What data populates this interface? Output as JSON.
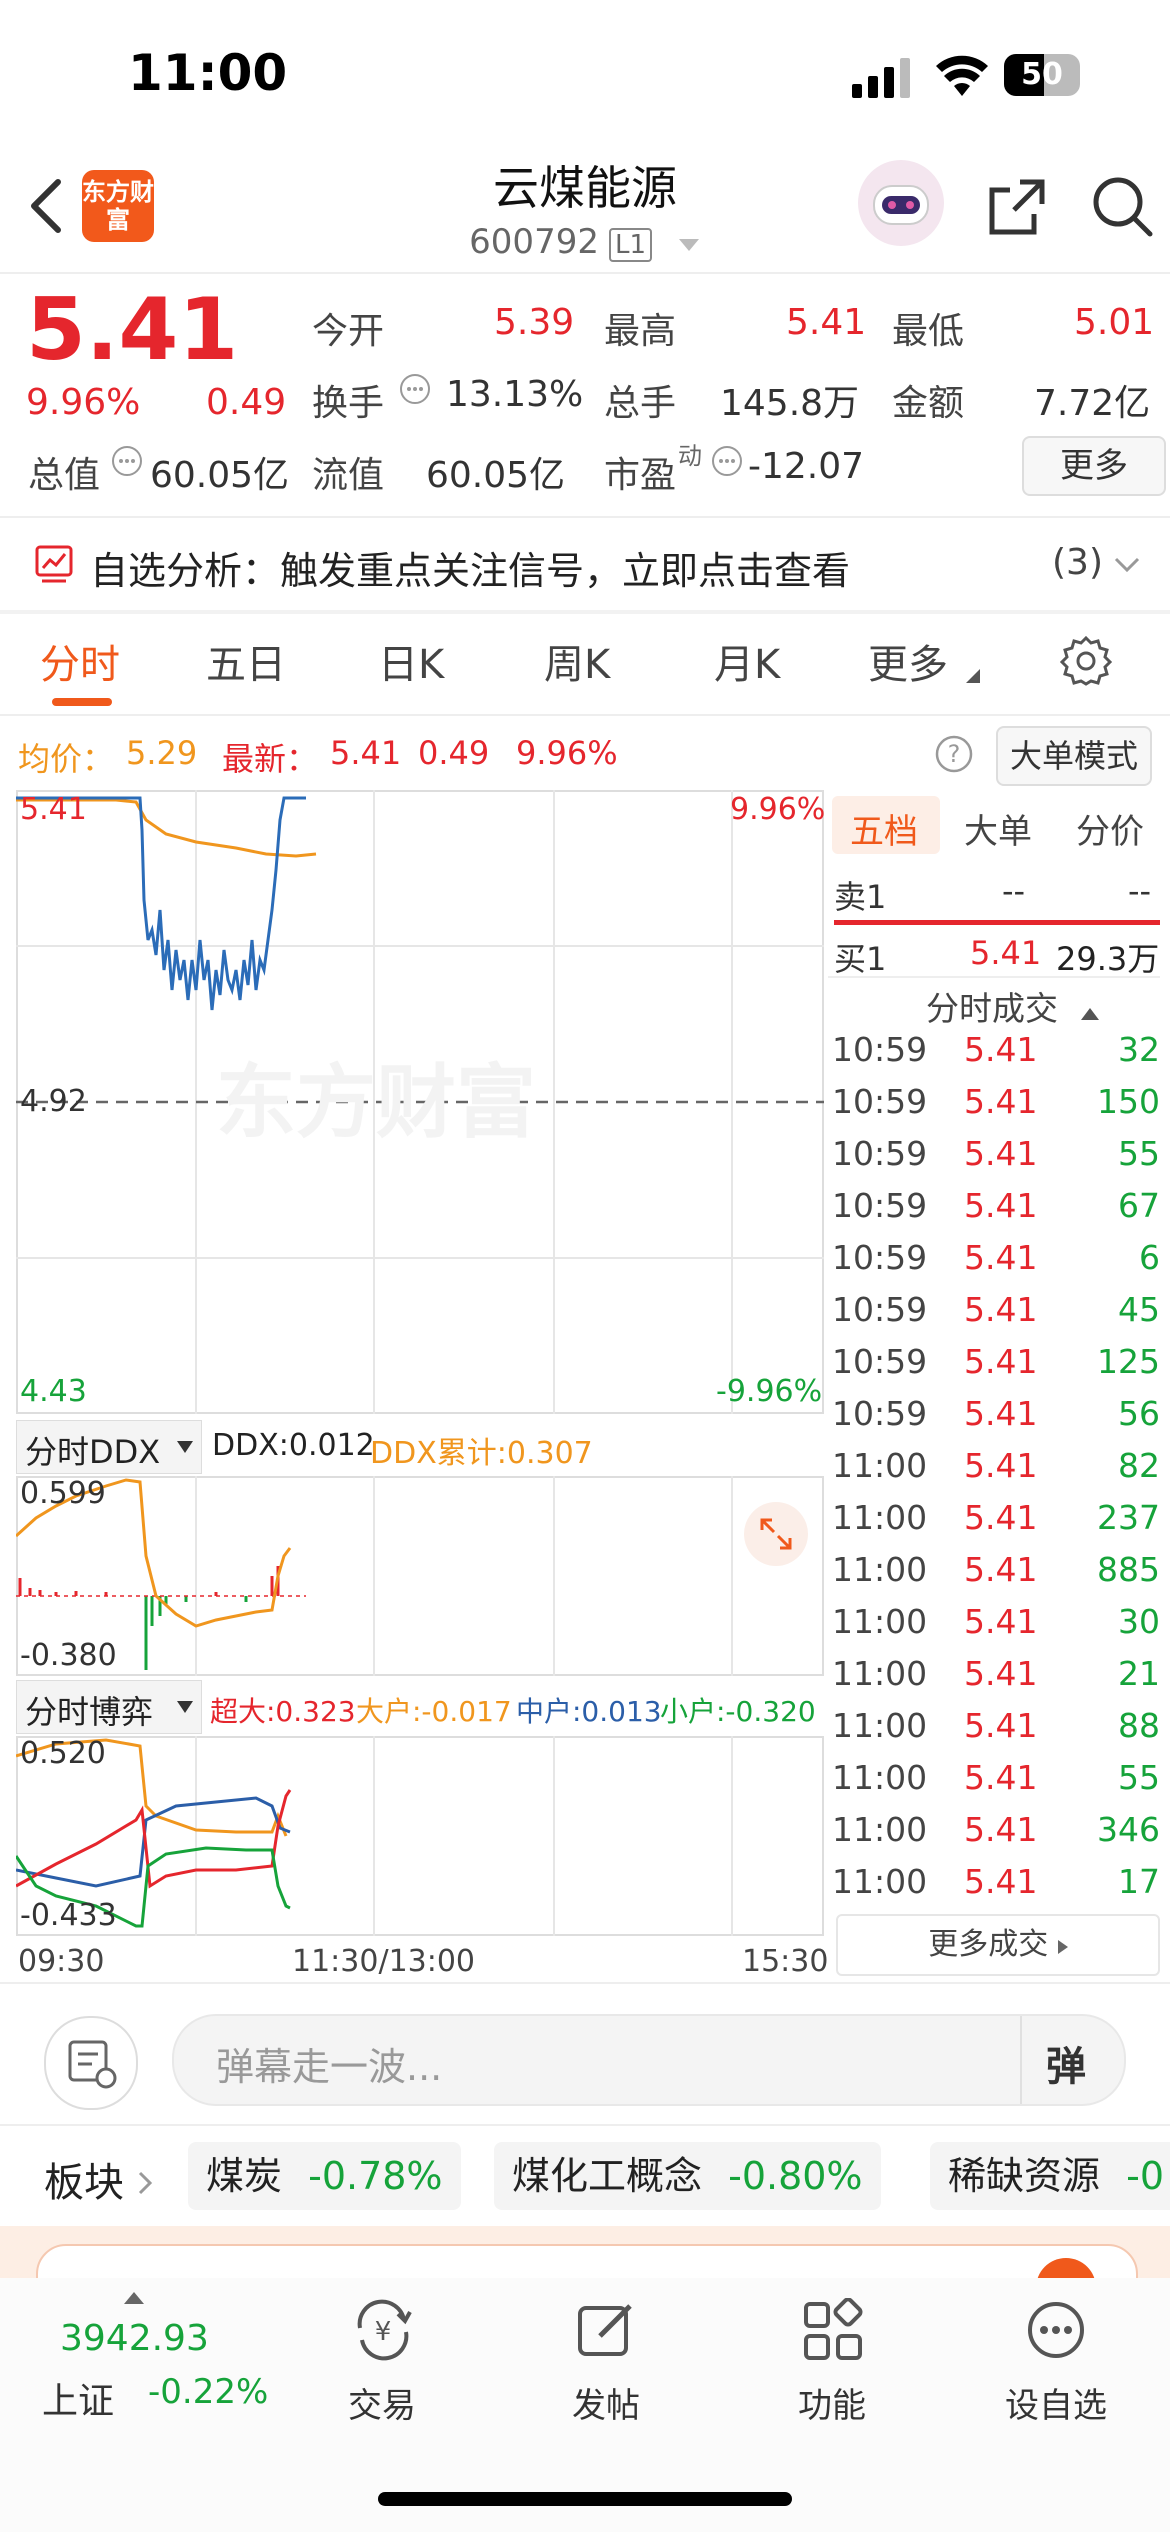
{
  "status_bar": {
    "time": "11:00",
    "battery": "50"
  },
  "header": {
    "logo_text": "东方财富",
    "title": "云煤能源",
    "code": "600792",
    "level": "L1"
  },
  "quote": {
    "price": "5.41",
    "change_pct": "9.96%",
    "change": "0.49",
    "open_label": "今开",
    "open": "5.39",
    "high_label": "最高",
    "high": "5.41",
    "low_label": "最低",
    "low": "5.01",
    "turnover_label": "换手",
    "turnover": "13.13%",
    "volume_label": "总手",
    "volume": "145.8万",
    "amount_label": "金额",
    "amount": "7.72亿",
    "mktcap_label": "总值",
    "mktcap": "60.05亿",
    "float_label": "流值",
    "float": "60.05亿",
    "pe_label": "市盈",
    "pe_sup": "动",
    "pe": "-12.07",
    "more_label": "更多"
  },
  "analysis_banner": {
    "text": "自选分析：触发重点关注信号，立即点击查看",
    "count": "(3)"
  },
  "tabs": [
    "分时",
    "五日",
    "日K",
    "周K",
    "月K",
    "更多"
  ],
  "chart_info": {
    "avg_label": "均价：",
    "avg": "5.29",
    "latest_label": "最新：",
    "latest": "5.41",
    "change": "0.49",
    "pct": "9.96%",
    "mode_button": "大单模式"
  },
  "price_axis": {
    "top": "5.41",
    "mid": "4.92",
    "bottom": "4.43",
    "top_pct": "9.96%",
    "bottom_pct": "-9.96%",
    "watermark": "东方财富"
  },
  "ddx_panel": {
    "selector": "分时DDX",
    "ddx_label": "DDX:0.012",
    "ddx_sum_label": "DDX累计:0.307",
    "top": "0.599",
    "bottom": "-0.380"
  },
  "game_panel": {
    "selector": "分时博弈",
    "super": "超大:0.323",
    "large": "大户:-0.017",
    "mid": "中户:0.013",
    "small": "小户:-0.320",
    "top": "0.520",
    "bottom": "-0.433"
  },
  "time_axis": [
    "09:30",
    "11:30/13:00",
    "15:30"
  ],
  "order_book": {
    "tabs": [
      "五档",
      "大单",
      "分价"
    ],
    "sell1": {
      "label": "卖1",
      "price": "--",
      "vol": "--"
    },
    "buy1": {
      "label": "买1",
      "price": "5.41",
      "vol": "29.3万"
    },
    "trades_title": "分时成交",
    "trades": [
      {
        "time": "10:59",
        "price": "5.41",
        "vol": "32"
      },
      {
        "time": "10:59",
        "price": "5.41",
        "vol": "150"
      },
      {
        "time": "10:59",
        "price": "5.41",
        "vol": "55"
      },
      {
        "time": "10:59",
        "price": "5.41",
        "vol": "67"
      },
      {
        "time": "10:59",
        "price": "5.41",
        "vol": "6"
      },
      {
        "time": "10:59",
        "price": "5.41",
        "vol": "45"
      },
      {
        "time": "10:59",
        "price": "5.41",
        "vol": "125"
      },
      {
        "time": "10:59",
        "price": "5.41",
        "vol": "56"
      },
      {
        "time": "11:00",
        "price": "5.41",
        "vol": "82"
      },
      {
        "time": "11:00",
        "price": "5.41",
        "vol": "237"
      },
      {
        "time": "11:00",
        "price": "5.41",
        "vol": "885"
      },
      {
        "time": "11:00",
        "price": "5.41",
        "vol": "30"
      },
      {
        "time": "11:00",
        "price": "5.41",
        "vol": "21"
      },
      {
        "time": "11:00",
        "price": "5.41",
        "vol": "88"
      },
      {
        "time": "11:00",
        "price": "5.41",
        "vol": "55"
      },
      {
        "time": "11:00",
        "price": "5.41",
        "vol": "346"
      },
      {
        "time": "11:00",
        "price": "5.41",
        "vol": "17"
      }
    ],
    "more_trades": "更多成交"
  },
  "comment": {
    "placeholder": "弹幕走一波...",
    "danmu_label": "弹"
  },
  "sectors": {
    "label": "板块",
    "items": [
      {
        "name": "煤炭",
        "pct": "-0.78%"
      },
      {
        "name": "煤化工概念",
        "pct": "-0.80%"
      },
      {
        "name": "稀缺资源",
        "pct": "-0"
      }
    ]
  },
  "bottom_nav": {
    "index_value": "3942.93",
    "index_name": "上证",
    "index_pct": "-0.22%",
    "items": [
      "交易",
      "发帖",
      "功能",
      "设自选"
    ]
  },
  "colors": {
    "accent": "#f0591b",
    "up": "#e5262d",
    "down": "#16a33a",
    "avg_line": "#f0961e",
    "price_line": "#2b6cb8"
  }
}
